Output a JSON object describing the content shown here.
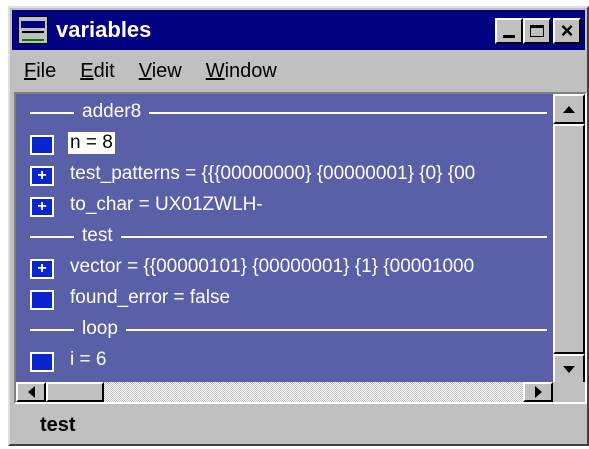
{
  "window": {
    "title": "variables"
  },
  "menu": [
    {
      "label": "File",
      "mnemonic": "F",
      "rest": "ile"
    },
    {
      "label": "Edit",
      "mnemonic": "E",
      "rest": "dit"
    },
    {
      "label": "View",
      "mnemonic": "V",
      "rest": "iew"
    },
    {
      "label": "Window",
      "mnemonic": "W",
      "rest": "indow"
    }
  ],
  "rows": [
    {
      "kind": "group",
      "text": "adder8"
    },
    {
      "kind": "var",
      "icon": "plain-square-icon",
      "text": "n = 8",
      "selected": true
    },
    {
      "kind": "var",
      "icon": "expand-icon",
      "text": "test_patterns = {{{00000000} {00000001} {0} {00"
    },
    {
      "kind": "var",
      "icon": "expand-icon",
      "text": "to_char = UX01ZWLH-"
    },
    {
      "kind": "group",
      "text": "test"
    },
    {
      "kind": "var",
      "icon": "expand-icon",
      "text": "vector = {{00000101} {00000001} {1} {00001000"
    },
    {
      "kind": "var",
      "icon": "plain-square-icon",
      "text": "found_error = false"
    },
    {
      "kind": "group",
      "text": "loop"
    },
    {
      "kind": "var",
      "icon": "plain-square-icon",
      "text": "i = 6"
    }
  ],
  "status": {
    "text": "test"
  },
  "colors": {
    "title_bar": "#000080",
    "list_background": "#5a60a8",
    "icon_fill": "#0a24d0",
    "chrome": "#c0c0c0"
  }
}
